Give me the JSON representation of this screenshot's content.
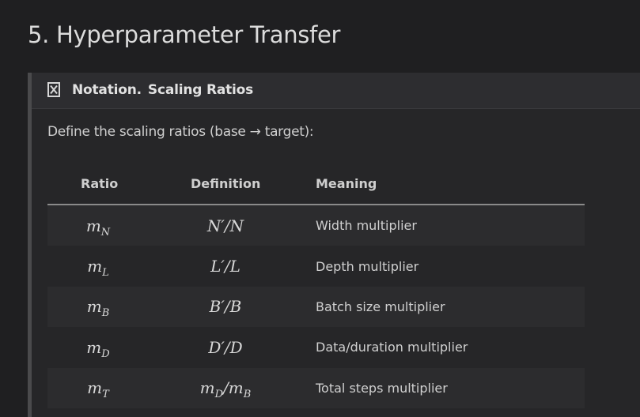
{
  "section": {
    "title": "5. Hyperparameter Transfer"
  },
  "callout": {
    "icon": "collapse-box-icon",
    "label": "Notation.",
    "title": "Scaling Ratios",
    "intro": "Define the scaling ratios (base → target):"
  },
  "table": {
    "headers": [
      "Ratio",
      "Definition",
      "Meaning"
    ],
    "rows": [
      {
        "ratio_base": "m",
        "ratio_sub": "N",
        "definition": "N′/N",
        "meaning": "Width multiplier"
      },
      {
        "ratio_base": "m",
        "ratio_sub": "L",
        "definition": "L′/L",
        "meaning": "Depth multiplier"
      },
      {
        "ratio_base": "m",
        "ratio_sub": "B",
        "definition": "B′/B",
        "meaning": "Batch size multiplier"
      },
      {
        "ratio_base": "m",
        "ratio_sub": "D",
        "definition": "D′/D",
        "meaning": "Data/duration multiplier"
      },
      {
        "ratio_base": "m",
        "ratio_sub": "T",
        "definition_parts": [
          "m",
          "D",
          "/m",
          "B"
        ],
        "meaning": "Total steps multiplier"
      }
    ]
  },
  "colors": {
    "background": "#1f1f21",
    "callout_bg": "#262628",
    "callout_header_bg": "#2d2d30",
    "callout_border": "#4a4a4c",
    "row_stripe": "#2c2c2e",
    "header_rule": "#8a8a8a"
  }
}
